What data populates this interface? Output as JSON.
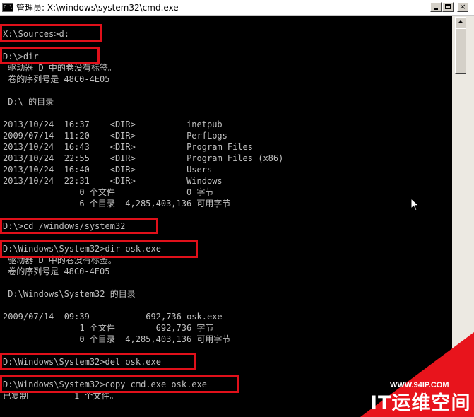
{
  "window": {
    "title": "管理员: X:\\windows\\system32\\cmd.exe",
    "icon_text": "C:\\",
    "controls": {
      "minimize": "minimize-icon",
      "maximize": "maximize-icon",
      "close": "×"
    }
  },
  "console": {
    "lines": [
      "X:\\Sources>d:",
      "",
      "D:\\>dir",
      " 驱动器 D 中的卷没有标签。",
      " 卷的序列号是 48C0-4E05",
      "",
      " D:\\ 的目录",
      "",
      "2013/10/24  16:37    <DIR>          inetpub",
      "2009/07/14  11:20    <DIR>          PerfLogs",
      "2013/10/24  16:43    <DIR>          Program Files",
      "2013/10/24  22:55    <DIR>          Program Files (x86)",
      "2013/10/24  16:40    <DIR>          Users",
      "2013/10/24  22:31    <DIR>          Windows",
      "               0 个文件              0 字节",
      "               6 个目录  4,285,403,136 可用字节",
      "",
      "D:\\>cd /windows/system32",
      "",
      "D:\\Windows\\System32>dir osk.exe",
      " 驱动器 D 中的卷没有标签。",
      " 卷的序列号是 48C0-4E05",
      "",
      " D:\\Windows\\System32 的目录",
      "",
      "2009/07/14  09:39           692,736 osk.exe",
      "               1 个文件        692,736 字节",
      "               0 个目录  4,285,403,136 可用字节",
      "",
      "D:\\Windows\\System32>del osk.exe",
      "",
      "D:\\Windows\\System32>copy cmd.exe osk.exe",
      "已复制         1 个文件。"
    ]
  },
  "watermark": {
    "url": "WWW.94IP.COM",
    "brand": "IT运维空间"
  },
  "colors": {
    "console_bg": "#000000",
    "console_text": "#c0c0c0",
    "highlight_border": "#e0101a",
    "watermark_red": "#e8141c"
  }
}
